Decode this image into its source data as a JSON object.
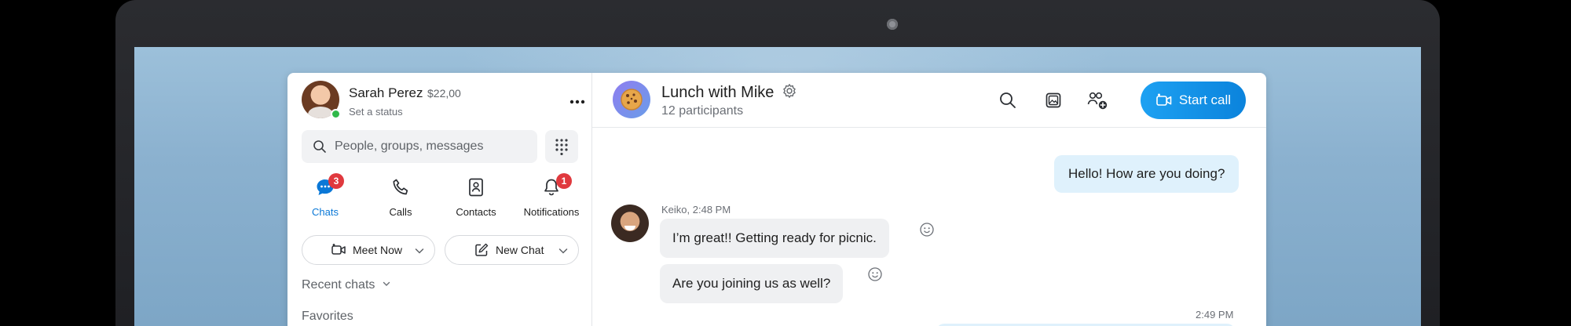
{
  "profile": {
    "name": "Sarah Perez",
    "credit": "$22,00",
    "status": "Set a status",
    "more_label": "•••"
  },
  "search": {
    "placeholder": "People, groups, messages"
  },
  "nav": {
    "tabs": [
      {
        "label": "Chats",
        "icon": "chat-icon",
        "badge": "3",
        "active": true
      },
      {
        "label": "Calls",
        "icon": "phone-icon",
        "badge": "",
        "active": false
      },
      {
        "label": "Contacts",
        "icon": "contacts-icon",
        "badge": "",
        "active": false
      },
      {
        "label": "Notifications",
        "icon": "bell-icon",
        "badge": "1",
        "active": false
      }
    ]
  },
  "actions": {
    "meet_now": "Meet Now",
    "new_chat": "New Chat"
  },
  "sections": {
    "recent": "Recent chats",
    "favorites": "Favorites"
  },
  "chat": {
    "title": "Lunch with Mike",
    "participants": "12 participants",
    "start_call": "Start call",
    "messages": {
      "out1": "Hello! How are you doing?",
      "keiko_meta": "Keiko, 2:48 PM",
      "in1": "I’m great!! Getting ready for picnic.",
      "in2": "Are you joining us as well?",
      "out_time": "2:49 PM"
    }
  },
  "colors": {
    "accent": "#0a78d7",
    "badge": "#e0393e",
    "presence": "#30b94a",
    "outgoing_bubble": "#dff1fc",
    "incoming_bubble": "#eff0f2"
  }
}
